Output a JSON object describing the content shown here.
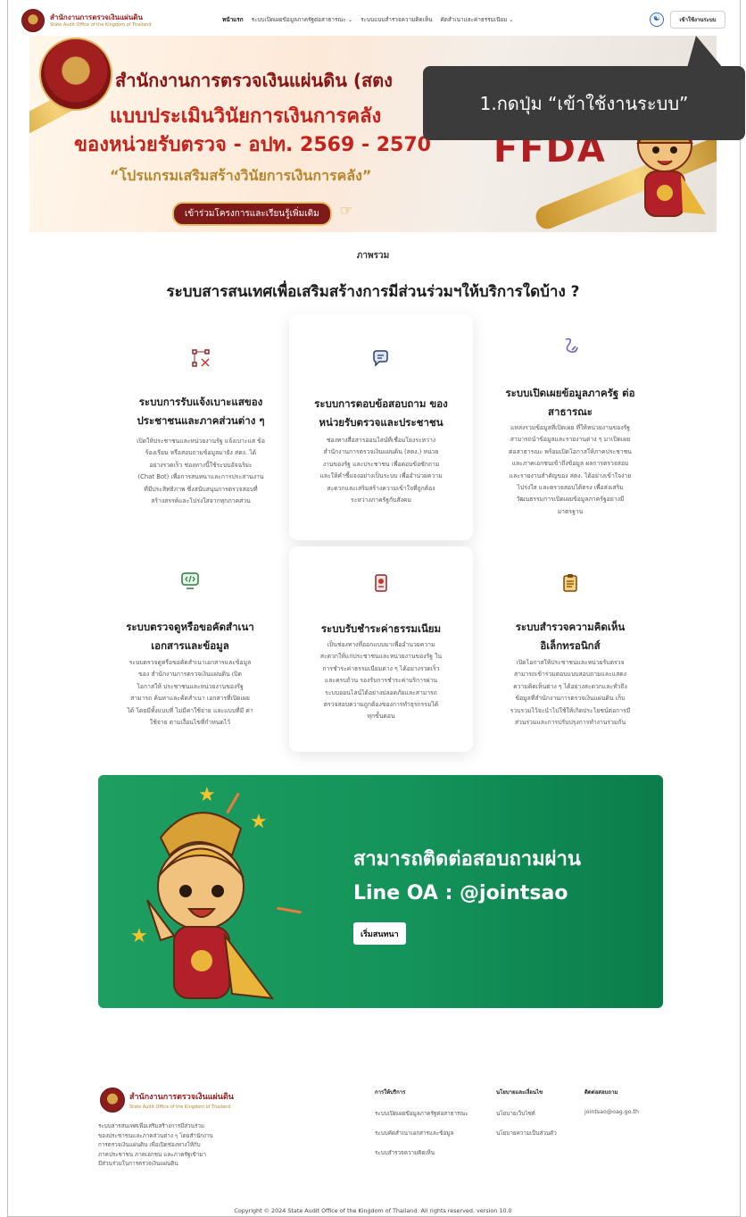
{
  "header": {
    "logo_th": "สำนักงานการตรวจเงินแผ่นดิน",
    "logo_en": "State Audit Office of the Kingdom of Thailand",
    "nav": [
      {
        "label": "หน้าแรก",
        "active": true
      },
      {
        "label": "ระบบเปิดเผยข้อมูลภาครัฐต่อสาธารณะ ⌄",
        "active": false
      },
      {
        "label": "ระบบแบบสำรวจความคิดเห็น",
        "active": false
      },
      {
        "label": "คัดสำเนาและค่าธรรมเนียม ⌄",
        "active": false
      }
    ],
    "accessibility_icon": "accessibility-icon",
    "login_label": "เข้าใช้งานระบบ"
  },
  "banner": {
    "title1": "สำนักงานการตรวจเงินแผ่นดิน (สตง",
    "title2": "แบบประเมินวินัยการเงินการคลัง",
    "title3": "ของหน่วยรับตรวจ - อปท. 2569 - 2570",
    "subtitle": "“โปรแกรมเสริมสร้างวินัยการเงินการคลัง”",
    "button": "เข้าร่วมโครงการและเรียนรู้เพิ่มเติม",
    "brand": "FFDA"
  },
  "tooltip": {
    "text": "1.กดปุ่ม “เข้าใช้งานระบบ”"
  },
  "overview": {
    "label": "ภาพรวม",
    "title": "ระบบสารสนเทศเพื่อเสริมสร้างการมีส่วนร่วมฯให้บริการใดบ้าง ?"
  },
  "cards": [
    {
      "icon": "report-icon",
      "title_lines": [
        "ระบบการรับแจ้งเบาะแสของ",
        "ประชาชนและภาคส่วนต่าง ๆ"
      ],
      "desc": [
        "เปิดให้ประชาชนและหน่วยงานรัฐ แจ้งเบาะแส ข้อ",
        "ร้องเรียน หรือสอบถามข้อมูลมายัง สตง. ได้",
        "อย่างรวดเร็ว ช่องทางนี้ใช้ระบบอัจฉริยะ",
        "(Chat Bot) เพื่อการสนทนาและการประสานงาน",
        "ที่มีประสิทธิภาพ ซึ่งสนับสนุนการตรวจสอบที่",
        "สร้างสรรค์และโปร่งใสจากทุกภาคส่วน"
      ]
    },
    {
      "icon": "chat-icon",
      "title_lines": [
        "ระบบการตอบข้อสอบถาม ของ",
        "หน่วยรับตรวจและประชาชน"
      ],
      "desc": [
        "ช่องทางสื่อสารออนไลน์ที่เชื่อมโยงระหว่าง",
        "สำนักงานการตรวจเงินแผ่นดิน (สตง.) หน่วย",
        "งานของรัฐ และประชาชน เพื่อตอบข้อซักถาม",
        "และให้คำชี้แจงอย่างเป็นระบบ เพื่ออำนวยความ",
        "สะดวกและเสริมสร้างความเข้าใจที่ถูกต้อง",
        "ระหว่างภาครัฐกับสังคม"
      ]
    },
    {
      "icon": "link-icon",
      "title_lines": [
        "ระบบเปิดเผยข้อมูลภาครัฐ ต่อ",
        "สาธารณะ"
      ],
      "desc": [
        "แหล่งรวมข้อมูลที่เปิดเผย ที่ให้หน่วยงานของรัฐ",
        "สามารถนำข้อมูลและรายงานต่าง ๆ มาเปิดเผย",
        "ต่อสาธารณะ พร้อมเปิดโอกาสให้ภาคประชาชน",
        "และภาคเอกชนเข้าถึงข้อมูล ผลการตรวจสอบ",
        "และรายงานสำคัญของ สตง. ได้อย่างเข้าใจง่าย",
        "โปร่งใส และตรวจสอบได้ตรง เพื่อส่งเสริม",
        "วัฒนธรรมการเปิดเผยข้อมูลภาครัฐอย่างมี",
        "มาตรฐาน"
      ]
    },
    {
      "icon": "code-monitor-icon",
      "title_lines": [
        "ระบบตรวจดูหรือขอคัดสำเนา",
        "เอกสารและข้อมูล"
      ],
      "desc": [
        "ระบบตรวจดูหรือขอคัดสำเนาเอกสารและข้อมูล",
        "ของ สำนักงานการตรวจเงินแผ่นดิน เปิด",
        "โอกาสให้ ประชาชนและหน่วยงานของรัฐ",
        "สามารถ ค้นหาและคัดสำเนา เอกสารที่เปิดเผย",
        "ได้ โดยมีทั้งแบบที่ ไม่มีค่าใช้จ่าย และแบบที่มี ค่า",
        "ใช้จ่าย ตามเงื่อนไขที่กำหนดไว้"
      ]
    },
    {
      "icon": "payment-icon",
      "title_lines": [
        "ระบบรับชำระค่าธรรมเนียม"
      ],
      "desc": [
        "เป็นช่องทางที่ออกแบบมาเพื่ออำนวยความ",
        "สะดวกให้แก่ประชาชนและหน่วยงานของรัฐ ใน",
        "การชำระค่าธรรมเนียมต่าง ๆ ได้อย่างรวดเร็ว",
        "และครบถ้วน รองรับการชำระค่าบริการผ่าน",
        "ระบบออนไลน์ได้อย่างปลอดภัยและสามารถ",
        "ตรวจสอบความถูกต้องของการทำธุรกรรมได้",
        "ทุกขั้นตอน"
      ]
    },
    {
      "icon": "clipboard-icon",
      "title_lines": [
        "ระบบสำรวจความคิดเห็น",
        "อิเล็กทรอนิกส์"
      ],
      "desc": [
        "เปิดโอกาสให้ประชาชนและหน่วยรับตรวจ",
        "สามารถเข้าร่วมตอบแบบสอบถามและแสดง",
        "ความคิดเห็นต่าง ๆ ได้อย่างสะดวกและทั่วถึง",
        "ข้อมูลที่สำนักงานการตรวจเงินแผ่นดิน เก็บ",
        "รวบรวมไว้จะนำไปใช้ให้เกิดประโยชน์ต่อการมี",
        "ส่วนร่วมและการปรับปรุงการทำงานร่วมกัน"
      ]
    }
  ],
  "cta": {
    "title_line1": "สามารถติดต่อสอบถามผ่าน",
    "title_line2": "Line OA : @jointsao",
    "button": "เริ่มสนทนา"
  },
  "footer": {
    "logo_th": "สำนักงานการตรวจเงินแผ่นดิน",
    "logo_en": "State Audit Office of the Kingdom of Thailand",
    "desc": [
      "ระบบสารสนเทศเพื่อเสริมสร้างการมีส่วนร่วม",
      "ของประชาชนและภาคส่วนต่าง ๆ โดยสำนักงาน",
      "การตรวจเงินแผ่นดิน เพื่อเปิดช่องทางให้กับ",
      "ภาคประชาชน ภาคเอกชน และภาครัฐเข้ามา",
      "มีส่วนร่วมในการตรวจเงินแผ่นดิน"
    ],
    "services_heading": "การให้บริการ",
    "services": [
      "ระบบเปิดเผยข้อมูลภาครัฐต่อสาธารณะ",
      "ระบบคัดสำเนาเอกสารและข้อมูล",
      "ระบบสำรวจความคิดเห็น"
    ],
    "policy_heading": "นโยบายและเงื่อนไข",
    "policies": [
      "นโยบายเว็บไซต์",
      "นโยบายความเป็นส่วนตัว"
    ],
    "contact_heading": "ติดต่อสอบถาม",
    "contact_email": "jointsao@oag.go.th",
    "copyright": "Copyright © 2024 State Audit Office of the Kingdom of Thailand. All rights reserved. version 10.0"
  }
}
